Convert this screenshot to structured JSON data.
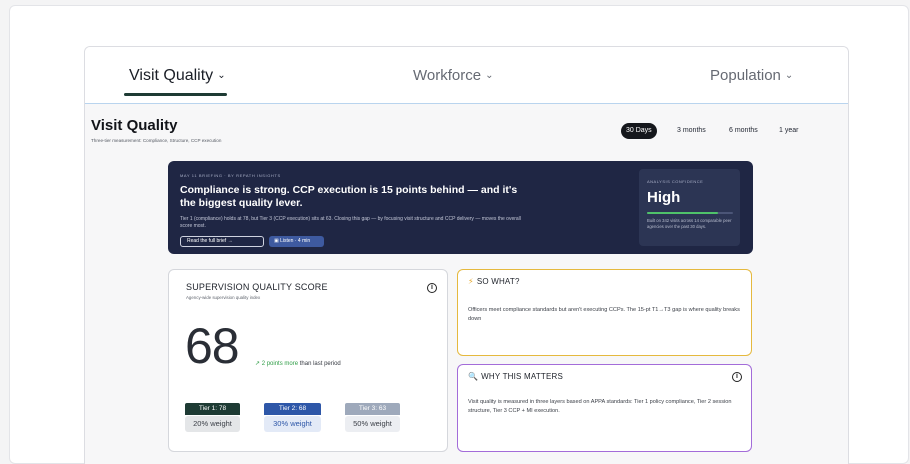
{
  "tabs": [
    {
      "label": "Visit Quality",
      "active": true
    },
    {
      "label": "Workforce",
      "active": false
    },
    {
      "label": "Population",
      "active": false
    }
  ],
  "chevron": "⌄",
  "page": {
    "title": "Visit Quality",
    "subtitle": "Three-tier measurement: Compliance, Structure, CCP execution"
  },
  "periods": [
    {
      "label": "30 Days",
      "active": true
    },
    {
      "label": "3 months",
      "active": false
    },
    {
      "label": "6 months",
      "active": false
    },
    {
      "label": "1 year",
      "active": false
    }
  ],
  "briefing": {
    "kicker": "MAY 11 BRIEFING · BY REPATH INSIGHTS",
    "headline": "Compliance is strong. CCP execution is 15 points behind — and it's the biggest quality lever.",
    "body": "Tier 1 (compliance) holds at 78, but Tier 3 (CCP execution) sits at 63. Closing this gap — by focusing visit structure and CCP delivery — moves the overall score most.",
    "read_button": "Read the full brief →",
    "listen_button": "Listen · 4 min",
    "confidence": {
      "label": "ANALYSIS CONFIDENCE",
      "value": "High",
      "level": 0.82,
      "note": "Built on 342 visits across 14 comparable peer agencies over the past 30 days."
    }
  },
  "score": {
    "title": "SUPERVISION QUALITY SCORE",
    "subtitle": "Agency-wide supervision quality index",
    "value": "68",
    "delta_arrow": "↗",
    "delta_text": "2 points more",
    "delta_suffix": "than last period",
    "tiers": [
      {
        "label": "Tier 1: 78",
        "weight": "20% weight",
        "color": "#1e3b34",
        "weight_bg": "#e4e6e8",
        "weight_color": "#3c4048"
      },
      {
        "label": "Tier 2: 68",
        "weight": "30% weight",
        "color": "#2e57a8",
        "weight_bg": "#e3eaf7",
        "weight_color": "#2e57a8"
      },
      {
        "label": "Tier 3: 63",
        "weight": "50% weight",
        "color": "#9ea9bb",
        "weight_bg": "#eceef2",
        "weight_color": "#3c4048"
      }
    ]
  },
  "so_what": {
    "icon": "⚡",
    "title": "SO WHAT?",
    "body": "Officers meet compliance standards but aren't executing CCPs. The 15-pt T1→T3 gap is where quality breaks down"
  },
  "why": {
    "icon": "🔍",
    "title": "WHY THIS MATTERS",
    "body": "Visit quality is measured in three layers based on APPA standards: Tier 1 policy compliance, Tier 2 session structure, Tier 3 CCP + MI execution."
  },
  "colors": {
    "accent_dark": "#1e3b34",
    "brief_bg": "#1f2644",
    "so_what_border": "#e5b93e",
    "why_border": "#a36cd9",
    "positive": "#2f9d46"
  }
}
